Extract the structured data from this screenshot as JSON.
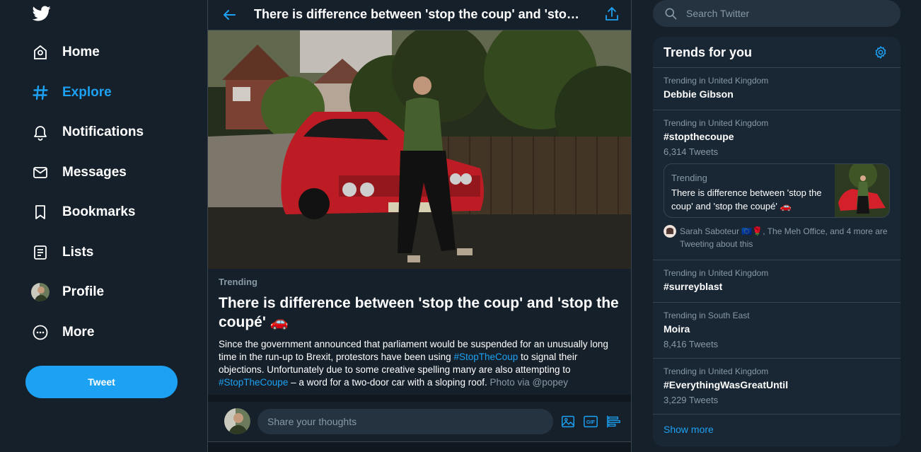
{
  "nav": {
    "items": [
      {
        "label": "Home",
        "icon": "home-icon"
      },
      {
        "label": "Explore",
        "icon": "hashtag-icon",
        "active": true
      },
      {
        "label": "Notifications",
        "icon": "bell-icon"
      },
      {
        "label": "Messages",
        "icon": "envelope-icon"
      },
      {
        "label": "Bookmarks",
        "icon": "bookmark-icon"
      },
      {
        "label": "Lists",
        "icon": "list-icon"
      },
      {
        "label": "Profile",
        "icon": "avatar"
      },
      {
        "label": "More",
        "icon": "more-circle-icon"
      }
    ],
    "tweet_label": "Tweet"
  },
  "header": {
    "title": "There is difference between 'stop the coup' and 'stop the coupé' 🚗"
  },
  "story": {
    "kicker": "Trending",
    "title": "There is difference between 'stop the coup' and 'stop the coupé' 🚗",
    "body_1": "Since the government announced that parliament would be suspended for an unusually long time in the run-up to Brexit, protestors have been using ",
    "link_1": "#StopTheCoup",
    "body_2": " to signal their objections. Unfortunately due to some creative spelling many are also attempting to ",
    "link_2": "#StopTheCoupe",
    "body_3": " – a word for a two-door car with a sloping roof. ",
    "credit": "Photo via @popey"
  },
  "compose": {
    "placeholder": "Share your thoughts"
  },
  "search": {
    "placeholder": "Search Twitter"
  },
  "trends": {
    "title": "Trends for you",
    "items": [
      {
        "context": "Trending in United Kingdom",
        "name": "Debbie Gibson",
        "count": ""
      },
      {
        "context": "Trending in United Kingdom",
        "name": "#stopthecoupe",
        "count": "6,314 Tweets"
      },
      {
        "context": "Trending in United Kingdom",
        "name": "#surreyblast",
        "count": ""
      },
      {
        "context": "Trending in South East",
        "name": "Moira",
        "count": "8,416 Tweets"
      },
      {
        "context": "Trending in United Kingdom",
        "name": "#EverythingWasGreatUntil",
        "count": "3,229 Tweets"
      }
    ],
    "card": {
      "kicker": "Trending",
      "text": "There is difference between 'stop the coup' and 'stop the coupé' 🚗"
    },
    "tweeting": "Sarah Saboteur 🇪🇺🌹, The Meh Office, and 4 more are Tweeting about this",
    "show_more": "Show more"
  },
  "colors": {
    "accent": "#1da1f2",
    "background": "#15202b",
    "panel": "#192734",
    "border": "#38444d",
    "muted_text": "#8899a6"
  }
}
